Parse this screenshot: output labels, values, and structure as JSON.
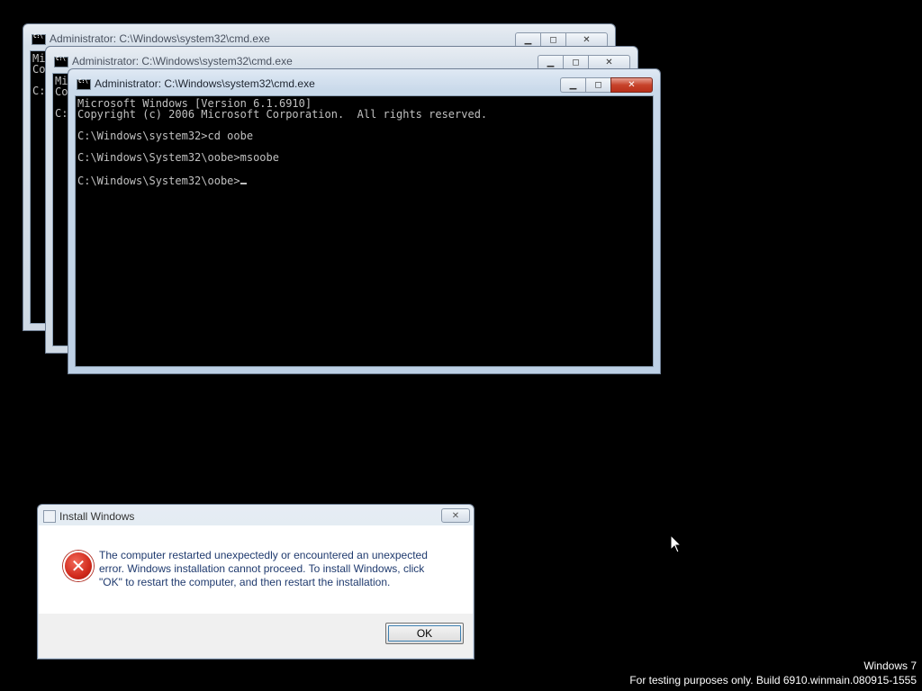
{
  "cmd_windows": [
    {
      "title": "Administrator: C:\\Windows\\system32\\cmd.exe",
      "lines": [
        "Mi",
        "Co",
        "",
        "C:"
      ]
    },
    {
      "title": "Administrator: C:\\Windows\\system32\\cmd.exe",
      "lines": [
        "Mi",
        "Co",
        "",
        "C:"
      ]
    },
    {
      "title": "Administrator: C:\\Windows\\system32\\cmd.exe",
      "lines": [
        "Microsoft Windows [Version 6.1.6910]",
        "Copyright (c) 2006 Microsoft Corporation.  All rights reserved.",
        "",
        "C:\\Windows\\system32>cd oobe",
        "",
        "C:\\Windows\\System32\\oobe>msoobe",
        "",
        "C:\\Windows\\System32\\oobe>"
      ]
    }
  ],
  "dialog": {
    "title": "Install Windows",
    "message": "The computer restarted unexpectedly or encountered an unexpected error. Windows installation cannot proceed. To install Windows, click \"OK\" to restart the computer, and then restart the installation.",
    "ok_label": "OK",
    "icon": "error-icon"
  },
  "watermark": {
    "line1": "Windows  7",
    "line2": "For testing purposes only. Build 6910.winmain.080915-1555"
  },
  "colors": {
    "desktop": "#000000",
    "console_text": "#c0c0c0",
    "close_button": "#c7422a",
    "error_red": "#d12a1c"
  }
}
